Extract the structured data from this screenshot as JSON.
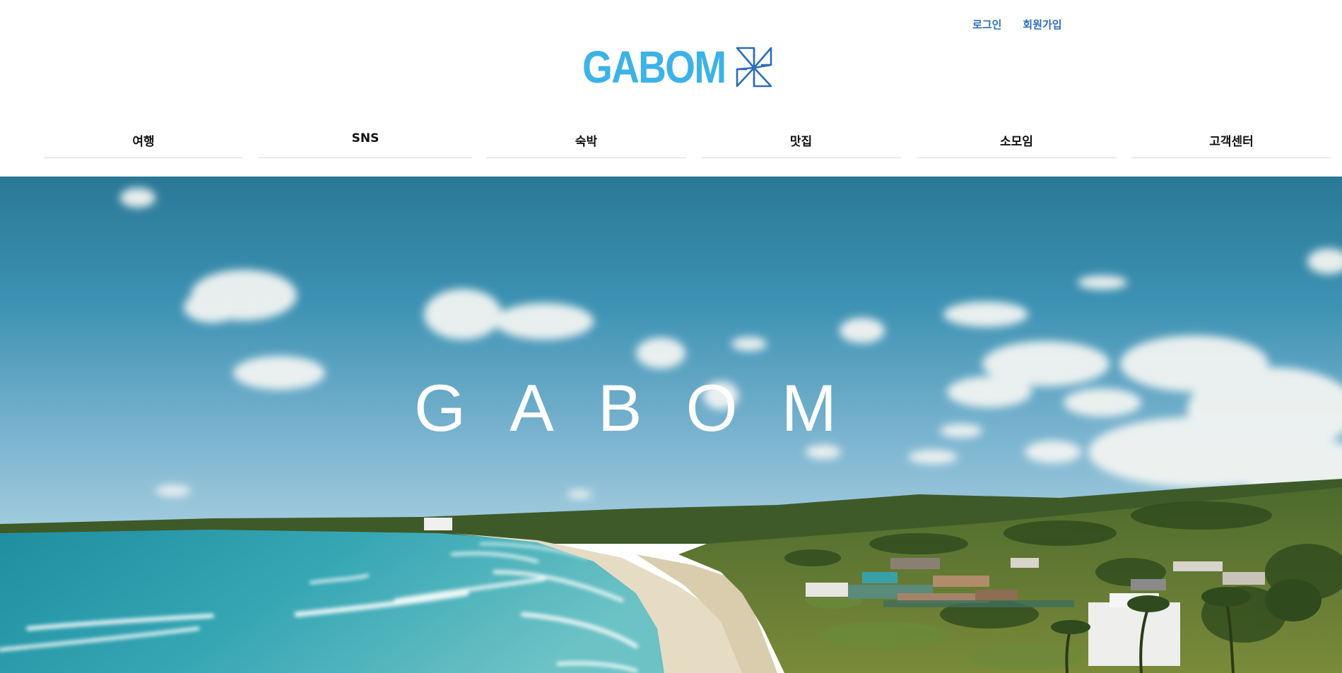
{
  "header": {
    "login_label": "로그인",
    "signup_label": "회원가입",
    "logo_text": "GABOM",
    "logo_icon": "pinwheel-icon",
    "brand_color": "#3db2e6",
    "link_color": "#2d6db5"
  },
  "nav": {
    "items": [
      {
        "label": "여행"
      },
      {
        "label": "SNS"
      },
      {
        "label": "숙박"
      },
      {
        "label": "맛집"
      },
      {
        "label": "소모임"
      },
      {
        "label": "고객센터"
      }
    ]
  },
  "hero": {
    "title": "GABOM",
    "image": "beach-aerial-photo"
  }
}
